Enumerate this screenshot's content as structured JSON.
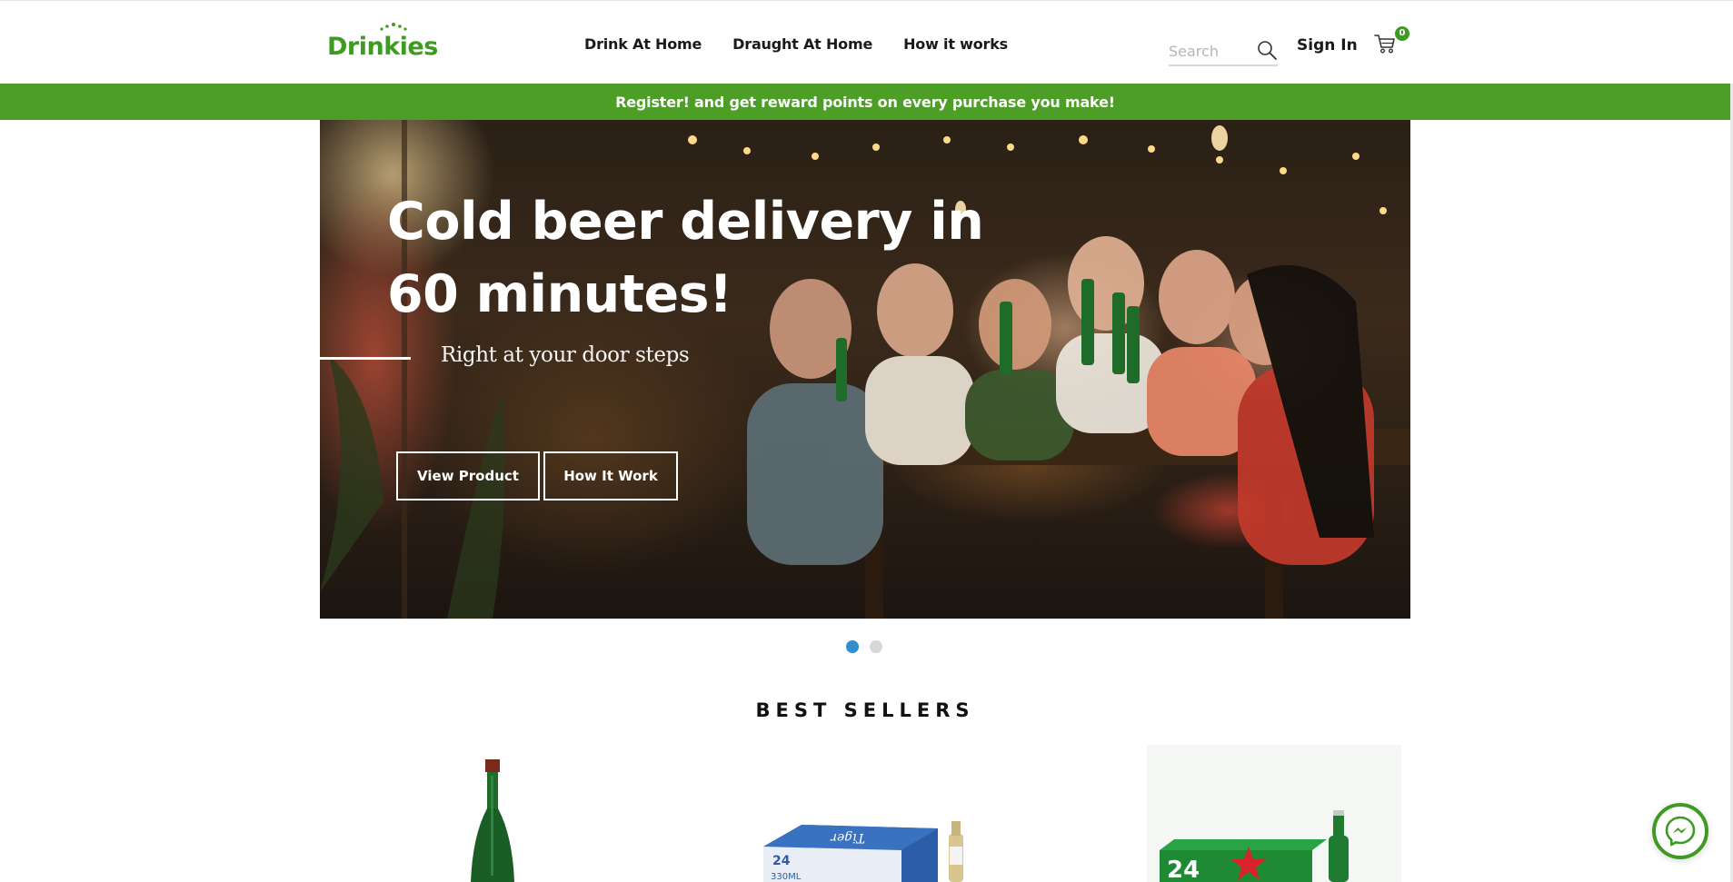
{
  "header": {
    "logo_text": "Drinkies",
    "nav": [
      {
        "label": "Drink At Home"
      },
      {
        "label": "Draught At Home"
      },
      {
        "label": "How it works"
      }
    ],
    "search_placeholder": "Search",
    "signin_label": "Sign In",
    "cart_count": "0"
  },
  "promo": {
    "text": "Register! and get reward points on every purchase you make!"
  },
  "hero": {
    "title_line1": "Cold beer delivery in",
    "title_line2": "60 minutes!",
    "subtitle": "Right at your door steps",
    "buttons": {
      "view_product": "View Product",
      "how_it_work": "How It Work"
    },
    "slides_total": 2,
    "active_slide": 1
  },
  "best_sellers": {
    "title": "BEST SELLERS",
    "products": [
      {
        "icon": "green-bottle-image"
      },
      {
        "icon": "tiger-beer-24-pack-image",
        "box_text": "24",
        "box_subtext": "330ML",
        "brand": "Tiger"
      },
      {
        "icon": "heineken-24-pack-image",
        "box_text": "24"
      }
    ]
  },
  "colors": {
    "brand_green": "#4c9e26",
    "logo_green": "#3e9b22",
    "dot_active": "#2f8fcf",
    "dot_inactive": "#d7d7d7"
  }
}
